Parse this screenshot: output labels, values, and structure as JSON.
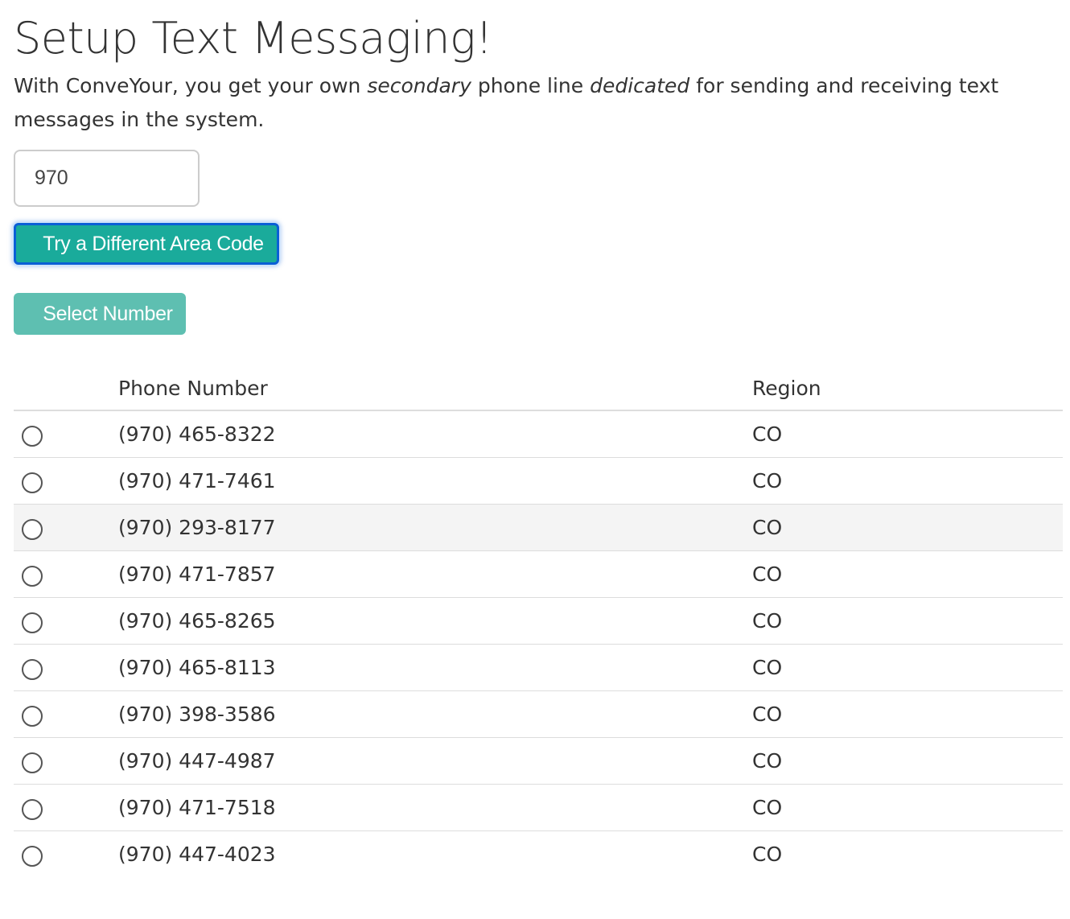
{
  "header": {
    "title": "Setup Text Messaging!"
  },
  "intro": {
    "part1": "With ConveYour, you get your own ",
    "em1": "secondary",
    "part2": " phone line ",
    "em2": "dedicated",
    "part3": " for sending and receiving text messages in the system."
  },
  "area_code": {
    "value": "970"
  },
  "buttons": {
    "try_area_code": "Try a Different Area Code",
    "select_number": "Select Number"
  },
  "table": {
    "columns": [
      "",
      "Phone Number",
      "Region"
    ],
    "rows": [
      {
        "phone": "(970) 465-8322",
        "region": "CO"
      },
      {
        "phone": "(970) 471-7461",
        "region": "CO"
      },
      {
        "phone": "(970) 293-8177",
        "region": "CO"
      },
      {
        "phone": "(970) 471-7857",
        "region": "CO"
      },
      {
        "phone": "(970) 465-8265",
        "region": "CO"
      },
      {
        "phone": "(970) 465-8113",
        "region": "CO"
      },
      {
        "phone": "(970) 398-3586",
        "region": "CO"
      },
      {
        "phone": "(970) 447-4987",
        "region": "CO"
      },
      {
        "phone": "(970) 471-7518",
        "region": "CO"
      },
      {
        "phone": "(970) 447-4023",
        "region": "CO"
      }
    ]
  },
  "colors": {
    "primary_button": "#1aab9b",
    "secondary_button": "#5ebfb1",
    "focus_ring": "#0b5fd6",
    "hover_row": "#f4f4f4"
  }
}
